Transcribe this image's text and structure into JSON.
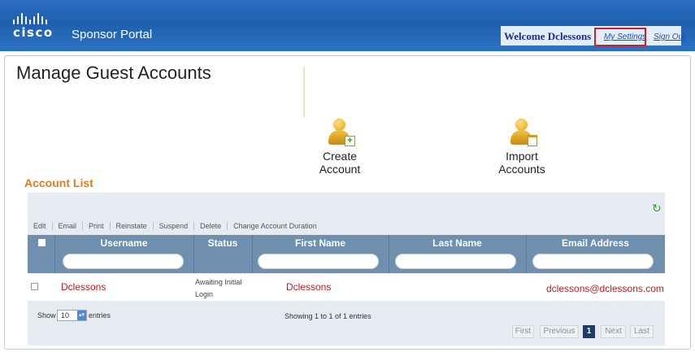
{
  "header": {
    "logo_text": "cisco",
    "portal_name": "Sponsor Portal",
    "welcome": "Welcome Dclessons",
    "my_settings": "My Settings",
    "sign_out": "Sign Out"
  },
  "page": {
    "title": "Manage Guest Accounts"
  },
  "actions": {
    "create": "Create Account",
    "import": "Import Accounts"
  },
  "account_list": {
    "title": "Account List",
    "toolbar": [
      "Edit",
      "Email",
      "Print",
      "Reinstate",
      "Suspend",
      "Delete",
      "Change Account Duration"
    ],
    "columns": [
      "Username",
      "Status",
      "First Name",
      "Last Name",
      "Email Address"
    ],
    "rows": [
      {
        "username": "Dclessons",
        "status": "Awaiting Initial Login",
        "first_name": "Dclessons",
        "last_name": "",
        "email": "dclessons@dclessons.com"
      }
    ],
    "show_label": "Show",
    "page_size": "10",
    "entries_label": "entries",
    "showing": "Showing 1 to 1 of 1 entries",
    "pagination": {
      "first": "First",
      "previous": "Previous",
      "current": "1",
      "next": "Next",
      "last": "Last"
    }
  },
  "colors": {
    "header_blue": "#2a6fc0",
    "section_orange": "#e07c1b",
    "table_header": "#6f8faf",
    "row_text_red": "#d0121b",
    "highlight_red": "#cf1f25"
  },
  "icons": [
    "cisco-logo",
    "add-user-icon",
    "import-users-icon",
    "refresh-icon"
  ]
}
